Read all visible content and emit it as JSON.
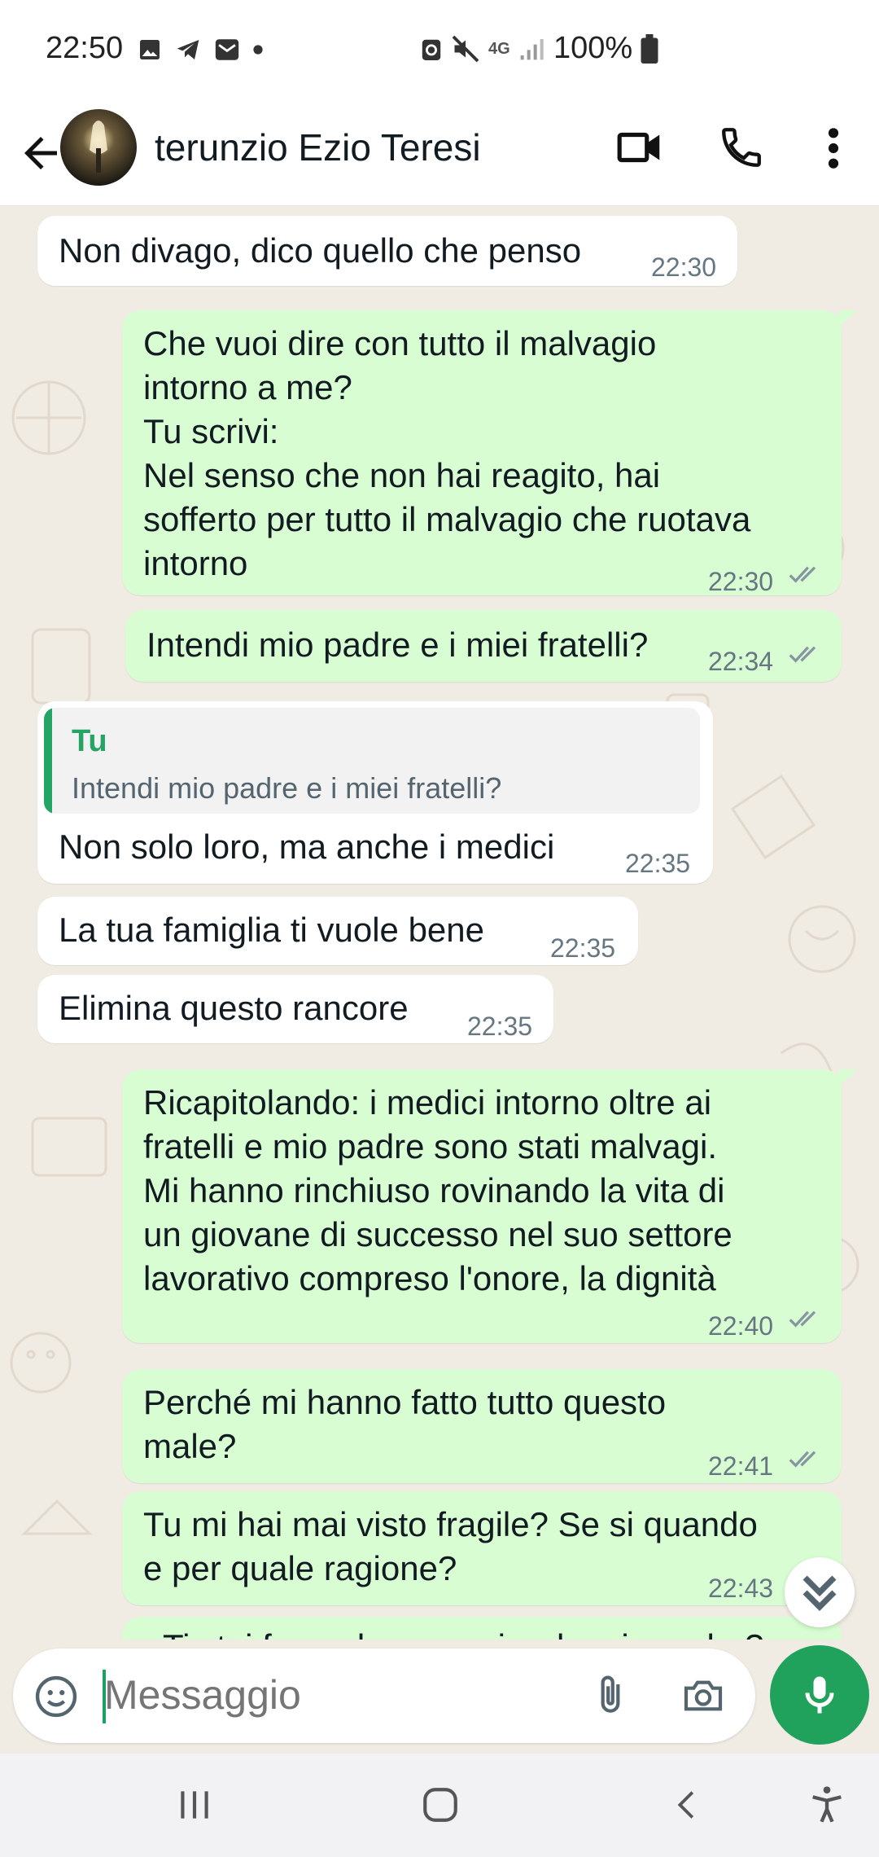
{
  "status_bar": {
    "time": "22:50",
    "left_icons": [
      "image-icon",
      "telegram-icon",
      "mail-icon",
      "dot-icon"
    ],
    "right_icons": [
      "sync-icon",
      "mute-icon",
      "4g-icon",
      "signal-icon",
      "battery-icon"
    ],
    "network": "4G",
    "battery": "100%"
  },
  "header": {
    "contact_name": "terunzio Ezio Teresi",
    "actions": [
      "video-call-icon",
      "phone-icon",
      "more-vert-icon"
    ]
  },
  "messages": [
    {
      "direction": "in",
      "text": "Non divago, dico quello che penso",
      "time": "22:30"
    },
    {
      "direction": "out",
      "lines": [
        "Che vuoi dire con tutto il malvagio",
        "intorno a me?",
        "Tu scrivi:",
        "Nel senso che non hai reagito, hai",
        "sofferto per tutto il malvagio che ruotava",
        "intorno"
      ],
      "time": "22:30",
      "status": "read"
    },
    {
      "direction": "out",
      "text": "Intendi mio padre e i miei fratelli?",
      "time": "22:34",
      "status": "read"
    },
    {
      "direction": "in",
      "quote": {
        "author": "Tu",
        "text": "Intendi mio padre e i miei fratelli?"
      },
      "text": "Non solo loro, ma anche i medici",
      "time": "22:35"
    },
    {
      "direction": "in",
      "text": "La tua famiglia ti vuole bene",
      "time": "22:35"
    },
    {
      "direction": "in",
      "text": "Elimina questo rancore",
      "time": "22:35"
    },
    {
      "direction": "out",
      "lines": [
        "Ricapitolando: i medici intorno oltre ai",
        "fratelli e mio padre sono stati malvagi.",
        "Mi hanno rinchiuso rovinando la vita di",
        "un giovane di successo nel suo settore",
        "lavorativo compreso l'onore, la dignità"
      ],
      "time": "22:40",
      "status": "read"
    },
    {
      "direction": "out",
      "lines": [
        "Perché mi hanno fatto tutto questo",
        "male?"
      ],
      "time": "22:41",
      "status": "read"
    },
    {
      "direction": "out",
      "lines": [
        "Tu mi hai mai visto fragile? Se si quando",
        "e per quale ragione?"
      ],
      "time": "22:43",
      "status": "read"
    },
    {
      "direction": "out",
      "text": "Ti stai facendo suggerire da mio padre?",
      "partial": true
    }
  ],
  "composer": {
    "placeholder": "Messaggio",
    "icons": [
      "emoji-icon",
      "attach-icon",
      "camera-icon",
      "mic-icon"
    ]
  },
  "nav_bar": {
    "buttons": [
      "recent-apps-icon",
      "home-icon",
      "back-nav-icon",
      "accessibility-icon"
    ]
  },
  "colors": {
    "outgoing_bubble": "#d9fdd3",
    "incoming_bubble": "#ffffff",
    "chat_background": "#f0ebe3",
    "accent": "#21a25c"
  }
}
